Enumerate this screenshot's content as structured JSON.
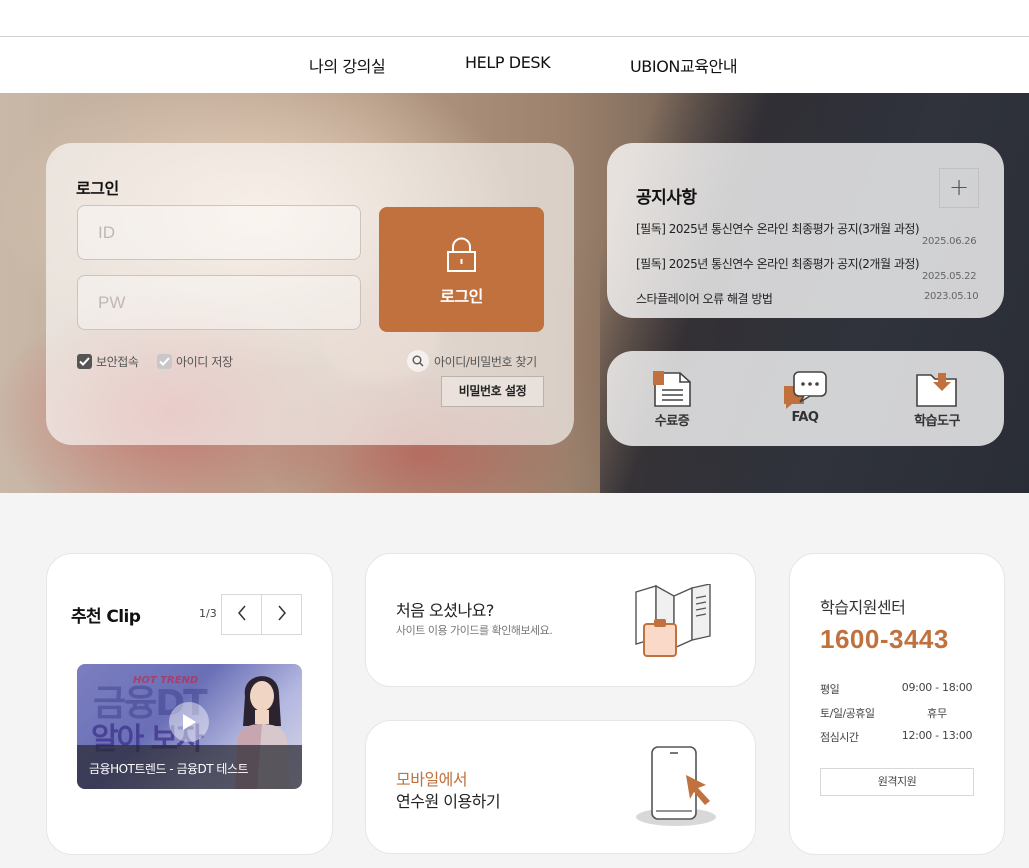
{
  "nav": {
    "items": [
      "나의 강의실",
      "HELP DESK",
      "UBION교육안내"
    ]
  },
  "login": {
    "title": "로그인",
    "id_placeholder": "ID",
    "pw_placeholder": "PW",
    "button_label": "로그인",
    "secure_label": "보안접속",
    "secure_checked": true,
    "save_id_label": "아이디 저장",
    "save_id_checked": false,
    "find_label": "아이디/비밀번호 찾기",
    "pw_set_label": "비밀번호 설정"
  },
  "notice": {
    "title": "공지사항",
    "more_label": "+",
    "items": [
      {
        "text": "[필독] 2025년 통신연수 온라인 최종평가 공지(3개월 과정)",
        "date": "2025.06.26"
      },
      {
        "text": "[필독] 2025년 통신연수 온라인 최종평가 공지(2개월 과정)",
        "date": "2025.05.22"
      },
      {
        "text": "스타플레이어 오류 해결 방법",
        "date": "2023.05.10"
      }
    ]
  },
  "quick": [
    {
      "label": "수료증",
      "icon": "certificate-icon"
    },
    {
      "label": "FAQ",
      "icon": "chat-bubbles-icon"
    },
    {
      "label": "학습도구",
      "icon": "folder-download-icon"
    }
  ],
  "clip": {
    "title": "추천 Clip",
    "counter": "1/3",
    "thumb_hot": "HOT TREND",
    "thumb_big1": "금융DT",
    "thumb_big2": "알아 보자",
    "caption": "금융HOT트렌드 - 금융DT 테스트"
  },
  "guide": {
    "title": "처음 오셨나요?",
    "subtitle": "사이트 이용 가이드를 확인해보세요."
  },
  "mobile": {
    "accent": "모바일에서",
    "text": "연수원 이용하기"
  },
  "support": {
    "title": "학습지원센터",
    "phone": "1600-3443",
    "hours": [
      {
        "label": "평일",
        "value": "09:00 - 18:00"
      },
      {
        "label": "토/일/공휴일",
        "value": "휴무"
      },
      {
        "label": "점심시간",
        "value": "12:00 - 13:00"
      }
    ],
    "remote_label": "원격지원"
  },
  "colors": {
    "accent": "#c0713e",
    "page_bg": "#f4f4f4"
  }
}
